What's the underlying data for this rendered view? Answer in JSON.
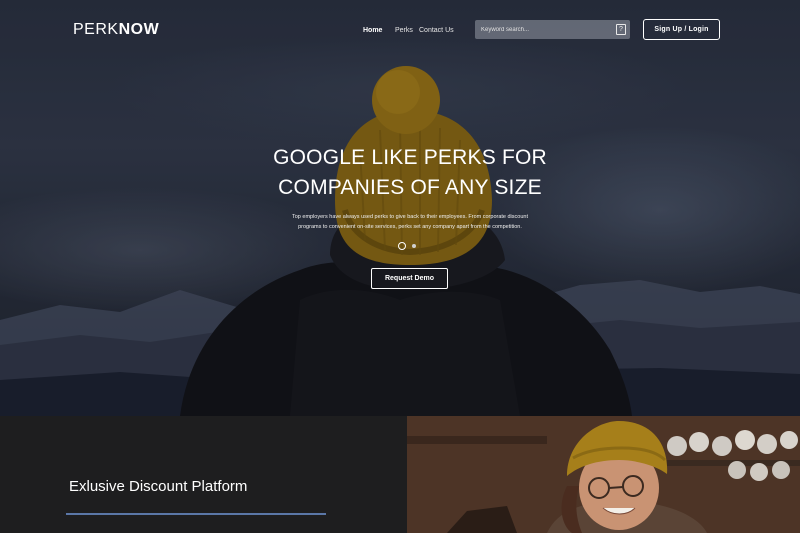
{
  "header": {
    "logo_part1": "PERK",
    "logo_part2": "NOW",
    "nav": [
      {
        "label": "Home"
      },
      {
        "label": "Perks"
      },
      {
        "label": "Contact Us"
      }
    ],
    "search": {
      "placeholder": "Keyword search...",
      "icon": "?"
    },
    "signup_label": "Sign Up / Login"
  },
  "hero": {
    "headline_line1": "GOOGLE LIKE PERKS FOR",
    "headline_line2": "COMPANIES OF ANY SIZE",
    "subtext_line1": "Top employers have always used perks to give back to their employees. From corporate discount",
    "subtext_line2": "programs to convenient on-site services, perks set any company apart from the competition.",
    "slides": {
      "count": 2,
      "active": 1
    },
    "cta_label": "Request Demo"
  },
  "features": {
    "title": "Exlusive Discount Platform",
    "accent_color": "#5b77a7"
  }
}
